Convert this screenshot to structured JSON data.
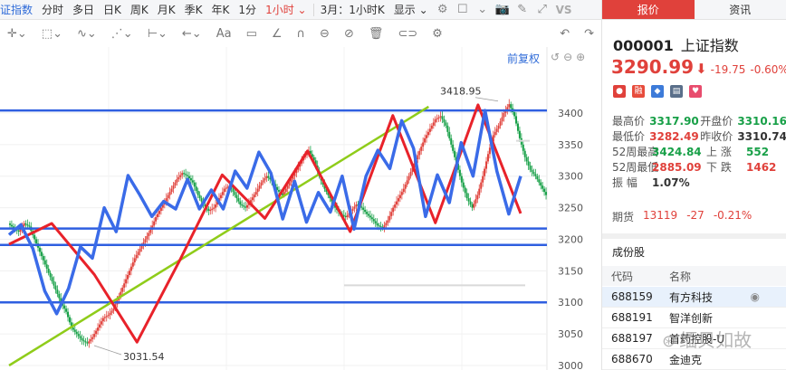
{
  "toolbar": {
    "items": [
      "证指数",
      "分时",
      "多日",
      "日K",
      "周K",
      "月K",
      "季K",
      "年K",
      "1分",
      "1小时",
      "3月：1小时K",
      "显示"
    ],
    "active_index": 9,
    "vs_label": "VS"
  },
  "chart_controls": {
    "adjust_label": "前复权"
  },
  "chart_data": {
    "type": "candlestick",
    "title": "",
    "ylim": [
      3000,
      3430
    ],
    "y_ticks": [
      3000,
      3050,
      3100,
      3150,
      3200,
      3250,
      3300,
      3350,
      3400
    ],
    "annotations": [
      {
        "label": "3418.95",
        "value": 3418.95
      },
      {
        "label": "3031.54",
        "value": 3031.54
      }
    ],
    "horizontal_levels": [
      3404,
      3217,
      3191,
      3100
    ],
    "trendline": {
      "from": [
        0,
        3000
      ],
      "to": [
        0.78,
        3410
      ]
    },
    "price_path": [
      3225,
      3218,
      3212,
      3225,
      3220,
      3200,
      3180,
      3160,
      3140,
      3120,
      3100,
      3085,
      3060,
      3050,
      3040,
      3035,
      3045,
      3060,
      3075,
      3080,
      3090,
      3110,
      3130,
      3150,
      3170,
      3185,
      3200,
      3215,
      3235,
      3250,
      3265,
      3280,
      3295,
      3305,
      3300,
      3290,
      3270,
      3255,
      3245,
      3250,
      3265,
      3280,
      3285,
      3270,
      3255,
      3250,
      3262,
      3275,
      3290,
      3300,
      3292,
      3278,
      3270,
      3285,
      3300,
      3315,
      3330,
      3340,
      3325,
      3300,
      3280,
      3265,
      3250,
      3240,
      3235,
      3245,
      3255,
      3250,
      3240,
      3232,
      3222,
      3218,
      3230,
      3250,
      3265,
      3280,
      3300,
      3320,
      3340,
      3360,
      3375,
      3390,
      3395,
      3380,
      3350,
      3320,
      3290,
      3265,
      3250,
      3270,
      3300,
      3335,
      3365,
      3380,
      3400,
      3414,
      3395,
      3360,
      3330,
      3310,
      3300,
      3285,
      3270
    ],
    "red_wave": [
      3192,
      3225,
      3144,
      3037,
      3166,
      3302,
      3233,
      3340,
      3212,
      3396,
      3226,
      3413,
      3241
    ],
    "blue_wave": [
      3207,
      3223,
      3185,
      3118,
      3082,
      3122,
      3188,
      3170,
      3250,
      3212,
      3301,
      3270,
      3236,
      3260,
      3248,
      3295,
      3248,
      3278,
      3248,
      3308,
      3281,
      3338,
      3305,
      3232,
      3292,
      3227,
      3274,
      3243,
      3300,
      3216,
      3300,
      3341,
      3312,
      3388,
      3344,
      3236,
      3302,
      3258,
      3353,
      3300,
      3404,
      3308,
      3240,
      3300
    ]
  },
  "quote": {
    "tabs": [
      "报价",
      "资讯"
    ],
    "code": "000001",
    "name": "上证指数",
    "price": "3290.99",
    "change": "-19.75",
    "change_pct": "-0.60%",
    "badges": [
      "●",
      "融",
      "◆",
      "▤",
      "♥"
    ],
    "stats": [
      {
        "k": "最高价",
        "v": "3317.90",
        "vcolor": "g",
        "k2": "开盘价",
        "v2": "3310.16",
        "v2color": "g"
      },
      {
        "k": "最低价",
        "v": "3282.49",
        "vcolor": "r",
        "k2": "昨收价",
        "v2": "3310.74",
        "v2color": "n"
      },
      {
        "k": "52周最高",
        "v": "3424.84",
        "vcolor": "g",
        "k2": "上 涨",
        "v2": "552",
        "v2color": "g"
      },
      {
        "k": "52周最低",
        "v": "2885.09",
        "vcolor": "r",
        "k2": "下 跌",
        "v2": "1462",
        "v2color": "r"
      },
      {
        "k": "振 幅",
        "v": "1.07%",
        "vcolor": "n",
        "k2": "",
        "v2": "",
        "v2color": "n"
      }
    ],
    "futures": {
      "label": "期货",
      "value": "13119",
      "change": "-27",
      "pct": "-0.21%"
    }
  },
  "constituents": {
    "title": "成份股",
    "headers": [
      "代码",
      "名称"
    ],
    "rows": [
      {
        "code": "688159",
        "name": "有方科技"
      },
      {
        "code": "688191",
        "name": "智洋创新"
      },
      {
        "code": "688197",
        "name": "首药控股-U"
      },
      {
        "code": "688670",
        "name": "金迪克"
      }
    ]
  },
  "watermark": "缅贝如故"
}
